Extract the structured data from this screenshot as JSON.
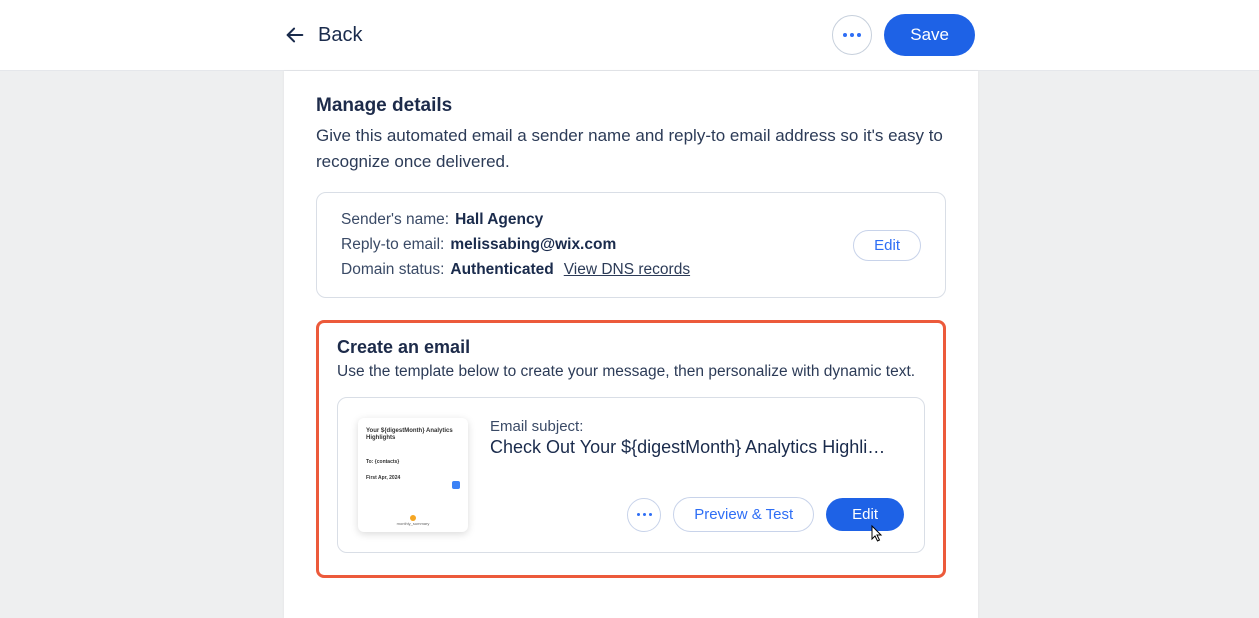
{
  "header": {
    "back_label": "Back",
    "save_label": "Save"
  },
  "manage": {
    "title": "Manage details",
    "description": "Give this automated email a sender name and reply-to email address so it's easy to recognize once delivered.",
    "sender_label": "Sender's name:",
    "sender_value": "Hall Agency",
    "reply_label": "Reply-to email:",
    "reply_value": "melissabing@wix.com",
    "domain_label": "Domain status:",
    "domain_value": "Authenticated",
    "dns_link": "View DNS records",
    "edit_label": "Edit"
  },
  "create": {
    "title": "Create an email",
    "description": "Use the template below to create your message, then personalize with dynamic text.",
    "subject_label": "Email subject:",
    "subject_value": "Check Out Your ${digestMonth} Analytics Highli…",
    "more_label": "More",
    "preview_label": "Preview & Test",
    "edit_label": "Edit",
    "thumb_title": "Your ${digestMonth} Analytics Highlights"
  }
}
